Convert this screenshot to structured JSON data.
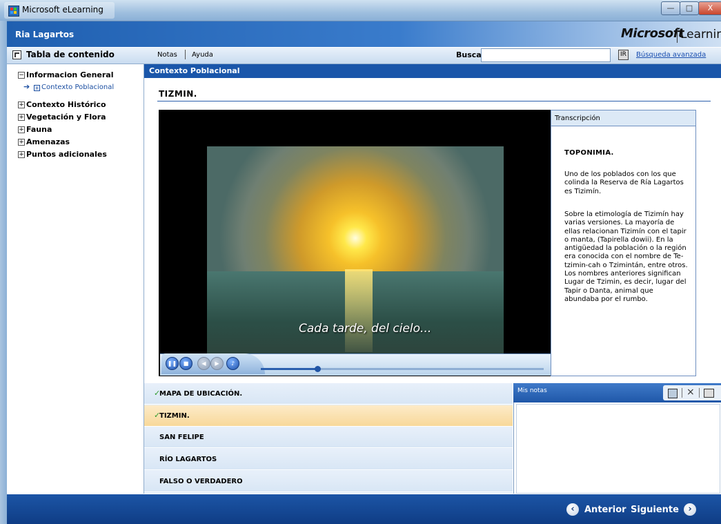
{
  "window": {
    "title": "Microsoft eLearning",
    "buttons": {
      "minimize": "—",
      "maximize": "□",
      "close": "X"
    }
  },
  "header": {
    "app_title": "Ria Lagartos",
    "brand_microsoft": "Microsoft",
    "brand_learning": "Learning"
  },
  "toolbar": {
    "toc_title": "Tabla de contenido",
    "notes": "Notas",
    "help": "Ayuda",
    "search_label": "Buscar",
    "search_value": "",
    "ir_icon": "IR",
    "advanced_search": "Búsqueda avanzada"
  },
  "toc": {
    "items": [
      {
        "label": "Informacion General",
        "box": "−"
      },
      {
        "label": "Contexto Histórico",
        "box": "+"
      },
      {
        "label": "Vegetación y Flora",
        "box": "+"
      },
      {
        "label": "Fauna",
        "box": "+"
      },
      {
        "label": "Amenazas",
        "box": "+"
      },
      {
        "label": "Puntos adicionales",
        "box": "+"
      }
    ],
    "sub_item": {
      "label": "Contexto Poblacional",
      "arrow": "➔",
      "box": "+"
    }
  },
  "content": {
    "section_title": "Contexto Poblacional",
    "topic_title": "TIZMIN.",
    "video_subtitle": "Cada tarde, del cielo..."
  },
  "player": {
    "progress": 0.2,
    "buttons": [
      "pause-icon",
      "stop-icon",
      "previous-icon",
      "next-icon",
      "volume-icon"
    ]
  },
  "transcript": {
    "title": "Transcripción",
    "heading": "TOPONIMIA.",
    "paragraphs": [
      "Uno de los poblados con los que colinda la Reserva de Ría Lagartos es Tizimín.",
      "Sobre la etimología de Tizimín hay varias versiones. La mayoría de ellas relacionan Tizimín con el tapir o manta, (Tapirella dowii). En la antigüedad la población o la región era conocida con el nombre de Te-tzimin-cah o Tzimintán, entre otros. Los nombres anteriores significan Lugar de Tzimin, es decir, lugar del Tapir o Danta, animal que abundaba por el rumbo."
    ]
  },
  "lessons": [
    {
      "label": "MAPA DE UBICACIÓN.",
      "check": "✓",
      "selected": false
    },
    {
      "label": "TIZMIN.",
      "check": "✓",
      "selected": true
    },
    {
      "label": "SAN FELIPE",
      "check": "",
      "selected": false
    },
    {
      "label": "RÍO LAGARTOS",
      "check": "",
      "selected": false
    },
    {
      "label": "FALSO O VERDADERO",
      "check": "",
      "selected": false
    }
  ],
  "notes": {
    "title": "Mis notas",
    "content": ""
  },
  "footer": {
    "prev_label": "Anterior",
    "next_label": "Siguiente",
    "prev_icon": "‹",
    "next_icon": "›"
  },
  "colors": {
    "accent": "#1a56aa",
    "selected_lesson": "#f8d89a",
    "check": "#2e9a2e"
  }
}
